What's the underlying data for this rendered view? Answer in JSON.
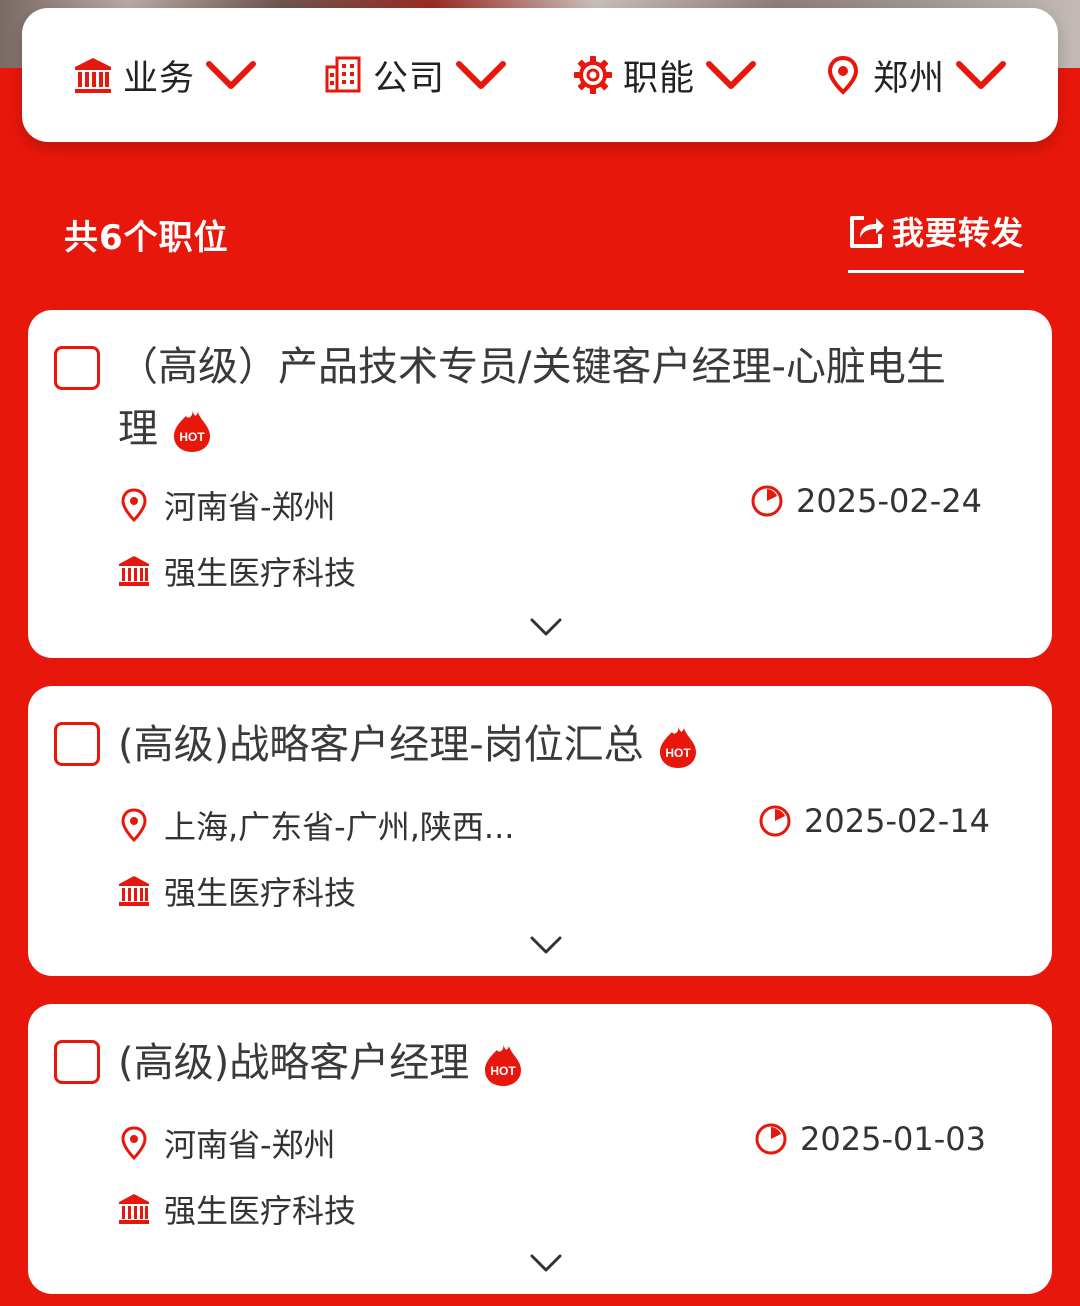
{
  "filters": [
    {
      "label": "业务",
      "icon": "bank-icon"
    },
    {
      "label": "公司",
      "icon": "building-icon"
    },
    {
      "label": "职能",
      "icon": "gear-icon"
    },
    {
      "label": "郑州",
      "icon": "location-pin-icon"
    }
  ],
  "summary": {
    "job_count": "共6个职位",
    "share_label": "我要转发"
  },
  "jobs": [
    {
      "title": "（高级）产品技术专员/关键客户经理-心脏电生理",
      "location": "河南省-郑州",
      "date": "2025-02-24",
      "company": "强生医疗科技",
      "hot": "HOT"
    },
    {
      "title": "(高级)战略客户经理-岗位汇总",
      "location": "上海,广东省-广州,陕西...",
      "date": "2025-02-14",
      "company": "强生医疗科技",
      "hot": "HOT"
    },
    {
      "title": "(高级)战略客户经理",
      "location": "河南省-郑州",
      "date": "2025-01-03",
      "company": "强生医疗科技",
      "hot": "HOT"
    }
  ],
  "colors": {
    "brand_red": "#e8170b",
    "card_bg": "#ffffff",
    "title_text": "#3a3a3a"
  }
}
